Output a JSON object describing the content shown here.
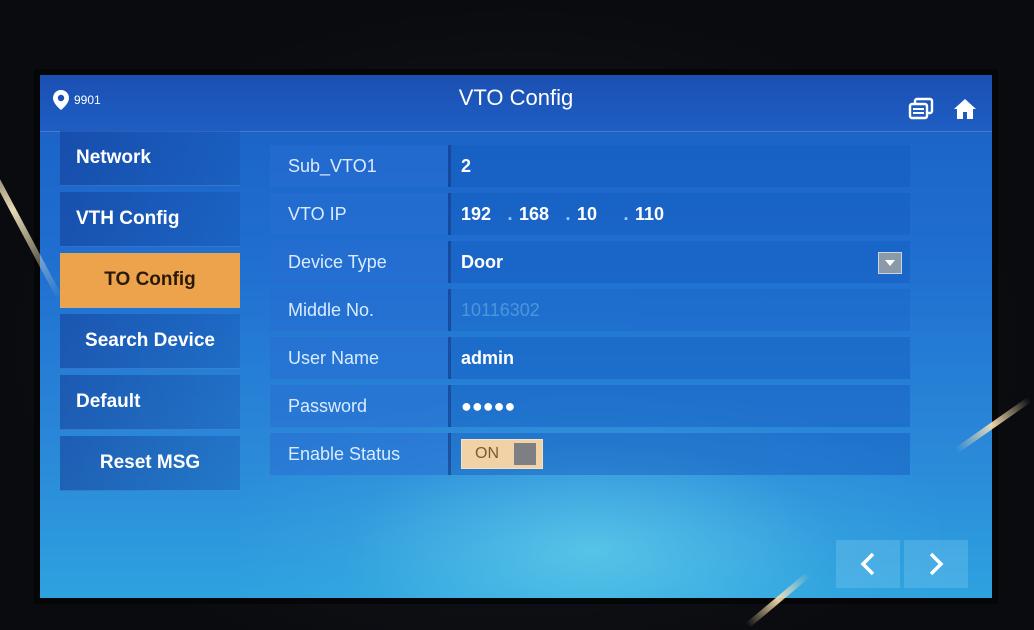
{
  "header": {
    "location": "9901",
    "title": "VTO Config",
    "icons": [
      "location-pin-icon",
      "messages-icon",
      "home-icon"
    ]
  },
  "sidebar": {
    "items": [
      {
        "label": "Network",
        "active": false
      },
      {
        "label": "VTH Config",
        "active": false
      },
      {
        "label": "TO Config",
        "active": true
      },
      {
        "label": "Search Device",
        "active": false
      },
      {
        "label": "Default",
        "active": false
      },
      {
        "label": "Reset MSG",
        "active": false
      }
    ]
  },
  "form": {
    "sub_vto": {
      "label": "Sub_VTO1",
      "value": "2"
    },
    "vto_ip": {
      "label": "VTO IP",
      "octets": [
        "192",
        "168",
        "10",
        "110"
      ]
    },
    "device_type": {
      "label": "Device Type",
      "value": "Door"
    },
    "middle_no": {
      "label": "Middle No.",
      "value": "10116302"
    },
    "user_name": {
      "label": "User Name",
      "value": "admin"
    },
    "password": {
      "label": "Password",
      "value": "●●●●●"
    },
    "enable_status": {
      "label": "Enable Status",
      "value": "ON"
    }
  },
  "pager": {
    "icons": [
      "chevron-left-icon",
      "chevron-right-icon"
    ]
  },
  "colors": {
    "accent": "#eda24c",
    "screen_top": "#1a5fc4",
    "screen_bottom": "#2ea2df",
    "header": "#1b4fb2"
  }
}
